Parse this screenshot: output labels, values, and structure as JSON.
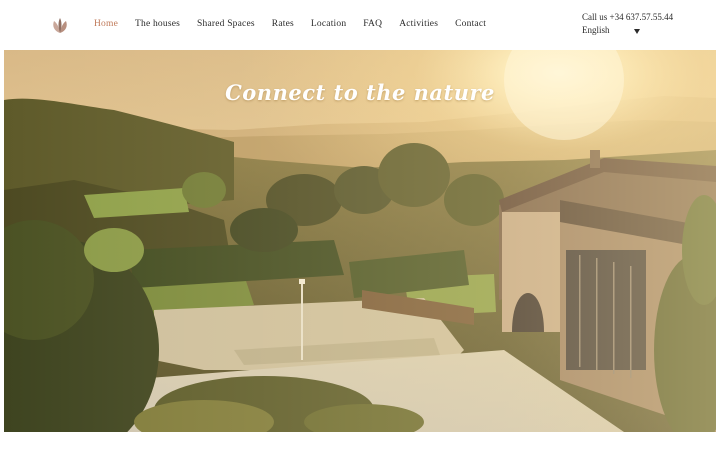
{
  "header": {
    "nav": [
      {
        "label": "Home",
        "active": true
      },
      {
        "label": "The houses",
        "active": false
      },
      {
        "label": "Shared Spaces",
        "active": false
      },
      {
        "label": "Rates",
        "active": false
      },
      {
        "label": "Location",
        "active": false
      },
      {
        "label": "FAQ",
        "active": false
      },
      {
        "label": "Activities",
        "active": false
      },
      {
        "label": "Contact",
        "active": false
      }
    ],
    "phone": "Call us +34 637.57.55.44",
    "language": "English"
  },
  "hero": {
    "title": "Connect to the nature"
  },
  "colors": {
    "accent": "#c07a5a",
    "text": "#2b2b2b",
    "background": "#ffffff"
  },
  "icons": {
    "logo": "leaf-logo-icon",
    "language_caret": "caret-down-icon"
  }
}
